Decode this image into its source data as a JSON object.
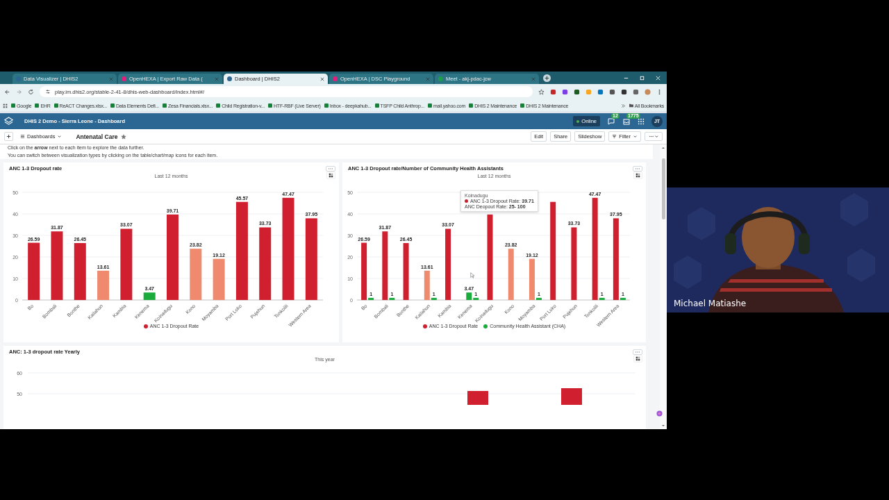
{
  "browser": {
    "tabs": [
      {
        "title": "Data Visualizer | DHIS2",
        "selected": false,
        "color": "#2c6693"
      },
      {
        "title": "OpenHEXA | Export Raw Data (",
        "selected": false,
        "color": "#e0207a"
      },
      {
        "title": "Dashboard | DHIS2",
        "selected": true,
        "color": "#2c6693"
      },
      {
        "title": "OpenHEXA | DSC Playground",
        "selected": false,
        "color": "#e0207a"
      },
      {
        "title": "Meet - akj-pdac-jcw",
        "selected": false,
        "color": "#1e9e4a"
      }
    ],
    "address": "play.im.dhis2.org/stable-2-41-8/dhis-web-dashboard/index.html#/",
    "bookmarks": [
      "Google",
      "EHR",
      "ReACT Changes.xlsx...",
      "Data Elements Defi...",
      "Zesa Financials.xlsx...",
      "Child Registration-v...",
      "HTF-RBF (Live Server)",
      "Inbox - deepkahub...",
      "TSFP Child Anthrop...",
      "mail.yahoo.com",
      "DHIS 2 Maintenance",
      "DHIS 2 Maintenance"
    ],
    "all_bookmarks": "All Bookmarks"
  },
  "header": {
    "title": "DHIS 2 Demo - Sierra Leone - Dashboard",
    "status": "Online",
    "messages": "12",
    "interpretations": "1775",
    "user_initials": "JT"
  },
  "dashboard_bar": {
    "dashboards_button": "Dashboards",
    "name": "Antenatal Care",
    "starred": true,
    "actions": [
      "Edit",
      "Share",
      "Slideshow"
    ],
    "filter": "Filter"
  },
  "intro": [
    "Click on the **arrow** next to each item to explore the data further.",
    "You can switch between visualization types by clicking on the table/chart/map icons for each item."
  ],
  "items": [
    {
      "title": "ANC 1-3 Dropout rate",
      "subtitle": "Last 12 months",
      "chart_data": {
        "type": "bar",
        "categories": [
          "Bo",
          "Bombali",
          "Bonthe",
          "Kailahun",
          "Kambia",
          "Kenema",
          "Koinadugu",
          "Kono",
          "Moyamba",
          "Port Loko",
          "Pujehun",
          "Tonkolili",
          "Western Area"
        ],
        "ylim": [
          0,
          50
        ],
        "yticks": [
          0,
          10,
          20,
          30,
          40,
          50
        ],
        "grid": true,
        "data_labels": true,
        "series": [
          {
            "name": "ANC 1-3 Dropout Rate",
            "color": "#d0202f",
            "values": [
              26.59,
              31.87,
              26.45,
              13.61,
              33.07,
              3.47,
              39.71,
              23.82,
              19.12,
              45.57,
              33.73,
              47.47,
              37.95
            ],
            "colors": [
              "#d0202f",
              "#d0202f",
              "#d0202f",
              "#ef8a6f",
              "#d0202f",
              "#1aab3c",
              "#d0202f",
              "#ef8a6f",
              "#ef8a6f",
              "#d0202f",
              "#d0202f",
              "#d0202f",
              "#d0202f"
            ]
          }
        ]
      }
    },
    {
      "title": "ANC 1-3 Dropout rate/Number of Community Health Assistants",
      "subtitle": "Last 12 months",
      "chart_data": {
        "type": "bar",
        "categories": [
          "Bo",
          "Bombali",
          "Bonthe",
          "Kailahun",
          "Kambia",
          "Kenema",
          "Koinadugu",
          "Kono",
          "Moyamba",
          "Port Loko",
          "Pujehun",
          "Tonkolili",
          "Western Area"
        ],
        "ylim": [
          0,
          50
        ],
        "yticks": [
          0,
          10,
          20,
          30,
          40,
          50
        ],
        "grid": true,
        "series": [
          {
            "name": "ANC 1-3 Dropout Rate",
            "color": "#d0202f",
            "values": [
              26.59,
              31.87,
              26.45,
              13.61,
              33.07,
              3.47,
              39.71,
              23.82,
              19.12,
              45.57,
              33.73,
              47.47,
              37.95
            ],
            "colors": [
              "#d0202f",
              "#d0202f",
              "#d0202f",
              "#ef8a6f",
              "#d0202f",
              "#1aab3c",
              "#d0202f",
              "#ef8a6f",
              "#ef8a6f",
              "#d0202f",
              "#d0202f",
              "#d0202f",
              "#d0202f"
            ]
          },
          {
            "name": "Community Health Assistant (CHA)",
            "color": "#1aab3c",
            "values": [
              1,
              1,
              null,
              1,
              null,
              1,
              null,
              null,
              1,
              null,
              null,
              1,
              1
            ]
          }
        ],
        "value_labels": [
          [
            "26.59",
            "31.87",
            "26.45",
            "13.61",
            "33.07",
            "3.47",
            null,
            "23.82",
            "19.12",
            null,
            "33.73",
            "47.47",
            "37.95"
          ],
          [
            "1",
            "1",
            null,
            "1",
            null,
            "1",
            null,
            null,
            "1",
            null,
            null,
            "1",
            "1"
          ]
        ]
      },
      "tooltip": {
        "title": "Koinadugu",
        "lines": [
          {
            "text": "ANC 1-3 Dropout Rate: **39.71**",
            "color": "#d0202f"
          },
          {
            "text": "ANC Deopout Rate: **25- 100**"
          }
        ]
      }
    }
  ],
  "wide_item": {
    "title": "ANC: 1-3 dropout rate Yearly",
    "subtitle": "This year",
    "axis_labels": [
      "60",
      "50"
    ]
  },
  "webcam": {
    "kind": "picture",
    "participant_name": "Michael Matiashe"
  }
}
